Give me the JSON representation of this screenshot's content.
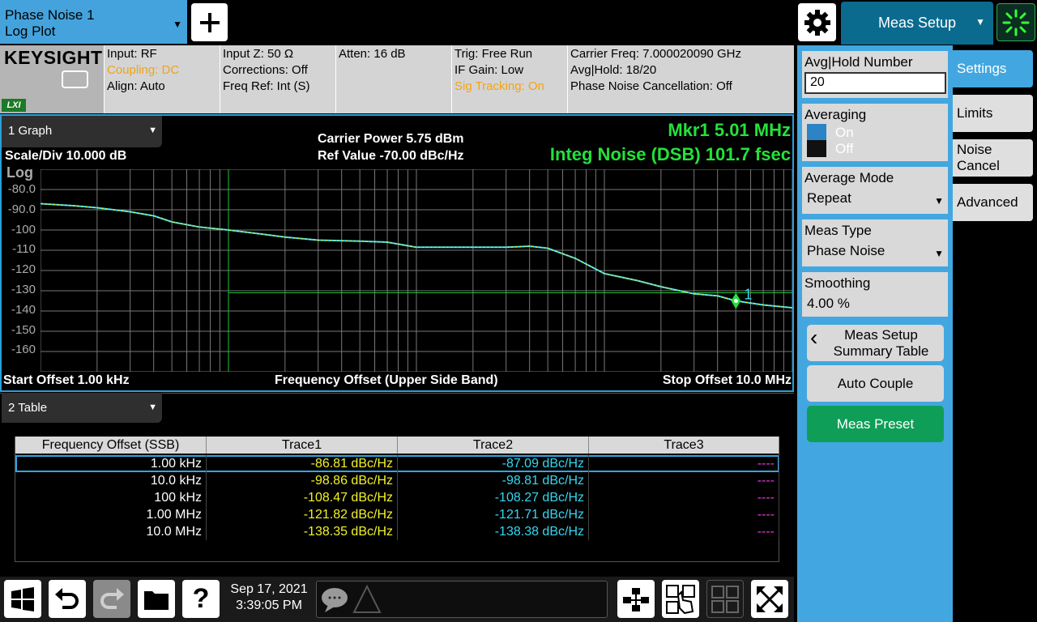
{
  "mode": {
    "line1": "Phase Noise 1",
    "line2": "Log Plot"
  },
  "top": {
    "meas_setup": "Meas Setup"
  },
  "logo": {
    "brand": "KEYSIGHT",
    "lxi": "LXI"
  },
  "info": {
    "input": "Input: RF",
    "coupling": "Coupling: DC",
    "align": "Align: Auto",
    "inputz": "Input Z: 50 Ω",
    "corrections": "Corrections: Off",
    "freqref": "Freq Ref: Int (S)",
    "atten": "Atten: 16 dB",
    "trig": "Trig: Free Run",
    "ifgain": "IF Gain: Low",
    "sigtrack": "Sig Tracking: On",
    "carrier": "Carrier Freq: 7.000020090 GHz",
    "avghold": "Avg|Hold: 18/20",
    "pnc": "Phase Noise Cancellation: Off"
  },
  "graph": {
    "window": "1 Graph",
    "scale": "Scale/Div 10.000 dB",
    "log": "Log",
    "carrier_power": "Carrier Power 5.75 dBm",
    "ref_value": "Ref Value -70.00 dBc/Hz",
    "marker": "Mkr1  5.01 MHz",
    "integ": "Integ Noise (DSB)  101.7 fsec",
    "start": "Start Offset 1.00 kHz",
    "xlabel": "Frequency Offset (Upper Side Band)",
    "stop": "Stop Offset 10.0 MHz",
    "yticks": [
      "-80.0",
      "-90.0",
      "-100",
      "-110",
      "-120",
      "-130",
      "-140",
      "-150",
      "-160"
    ],
    "marker_label": "1"
  },
  "chart_data": {
    "type": "line",
    "xscale": "log",
    "xlim": [
      1000,
      10000000
    ],
    "ylim": [
      -170,
      -70
    ],
    "series": [
      {
        "name": "Trace1",
        "x": [
          1000,
          1500,
          2000,
          3000,
          4000,
          5000,
          7000,
          10000,
          15000,
          20000,
          30000,
          50000,
          70000,
          100000,
          200000,
          300000,
          400000,
          500000,
          700000,
          1000000,
          1500000,
          2000000,
          3000000,
          4000000,
          5010000,
          7000000,
          10000000
        ],
        "y": [
          -87,
          -88,
          -89,
          -91,
          -93,
          -96,
          -98.5,
          -100,
          -102,
          -103.5,
          -105,
          -105.5,
          -106,
          -108.5,
          -108.5,
          -108.5,
          -108,
          -109,
          -114,
          -121.5,
          -125,
          -128,
          -131.5,
          -132.5,
          -135,
          -137,
          -138.4
        ]
      }
    ],
    "marker": {
      "x": 5010000,
      "y": -135
    }
  },
  "table": {
    "window": "2 Table",
    "headers": [
      "Frequency Offset (SSB)",
      "Trace1",
      "Trace2",
      "Trace3"
    ],
    "rows": [
      [
        "1.00 kHz",
        "-86.81 dBc/Hz",
        "-87.09 dBc/Hz",
        "----"
      ],
      [
        "10.0 kHz",
        "-98.86 dBc/Hz",
        "-98.81 dBc/Hz",
        "----"
      ],
      [
        "100 kHz",
        "-108.47 dBc/Hz",
        "-108.27 dBc/Hz",
        "----"
      ],
      [
        "1.00 MHz",
        "-121.82 dBc/Hz",
        "-121.71 dBc/Hz",
        "----"
      ],
      [
        "10.0 MHz",
        "-138.35 dBc/Hz",
        "-138.38 dBc/Hz",
        "----"
      ]
    ]
  },
  "bottom": {
    "date": "Sep 17, 2021",
    "time": "3:39:05 PM"
  },
  "panel": {
    "avg_hold_label": "Avg|Hold Number",
    "avg_hold_value": "20",
    "averaging_label": "Averaging",
    "averaging_on": "On",
    "averaging_off": "Off",
    "avg_mode_label": "Average Mode",
    "avg_mode_value": "Repeat",
    "meas_type_label": "Meas Type",
    "meas_type_value": "Phase Noise",
    "smoothing_label": "Smoothing",
    "smoothing_value": "4.00 %",
    "summary_btn": "Meas Setup Summary Table",
    "auto_couple": "Auto Couple",
    "meas_preset": "Meas Preset"
  },
  "tabs": {
    "settings": "Settings",
    "limits": "Limits",
    "noise_cancel": "Noise Cancel",
    "advanced": "Advanced"
  },
  "colors": {
    "accent": "#42a7e0",
    "trace1": "#f2f22a",
    "trace2": "#35d7f0",
    "marker_text": "#23e23a",
    "preset": "#0e9e57"
  }
}
